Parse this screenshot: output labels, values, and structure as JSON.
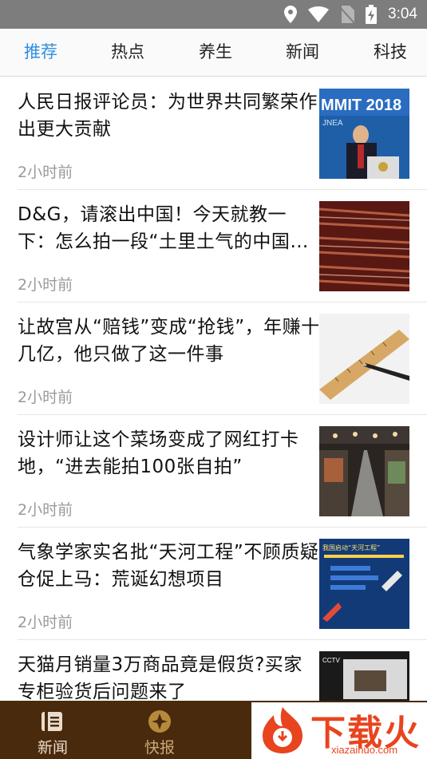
{
  "status_bar": {
    "time": "3:04"
  },
  "tabs": [
    {
      "label": "推荐",
      "active": true
    },
    {
      "label": "热点",
      "active": false
    },
    {
      "label": "养生",
      "active": false
    },
    {
      "label": "新闻",
      "active": false
    },
    {
      "label": "科技",
      "active": false
    }
  ],
  "feed": {
    "items": [
      {
        "title": "人民日报评论员：为世界共同繁荣作出更大贡献",
        "time": "2小时前",
        "thumb_text": "MMIT 2018"
      },
      {
        "title": "D&G，请滚出中国！今天就教一下：怎么拍一段“土里土气的中国…",
        "time": "2小时前"
      },
      {
        "title": "让故宫从“赔钱”变成“抢钱”，年赚十几亿，他只做了这一件事",
        "time": "2小时前"
      },
      {
        "title": "设计师让这个菜场变成了网红打卡地，“进去能拍100张自拍”",
        "time": "2小时前"
      },
      {
        "title": "气象学家实名批“天河工程”不顾质疑仓促上马：荒诞幻想项目",
        "time": "2小时前",
        "thumb_text": "我国启动“天河工程”"
      },
      {
        "title": "天猫月销量3万商品竟是假货?买家专柜验货后问题来了",
        "time": ""
      }
    ]
  },
  "bottom_nav": [
    {
      "label": "新闻",
      "icon": "news-icon"
    },
    {
      "label": "快报",
      "icon": "express-icon"
    }
  ],
  "watermark": {
    "text": "下载火",
    "sub": "xiazaihuo.com"
  },
  "colors": {
    "accent": "#2f8fe0",
    "nav_bg": "#4a2a0c",
    "status_bg": "#7d7d7d",
    "watermark": "#e8441e"
  }
}
